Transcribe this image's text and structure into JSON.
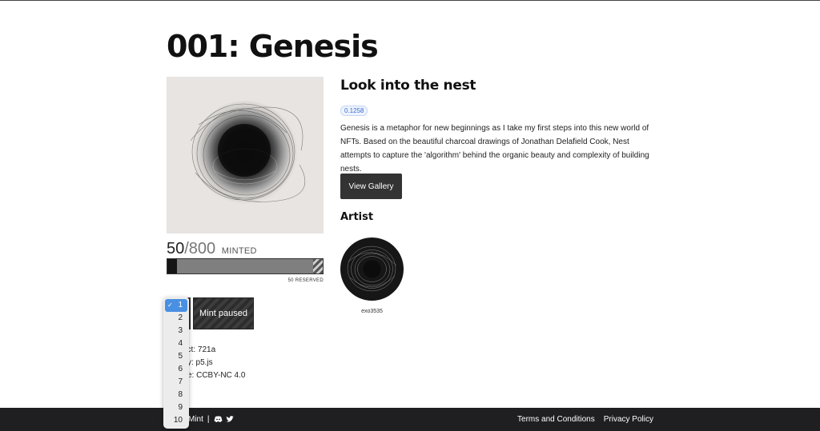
{
  "page": {
    "title": "001: Genesis"
  },
  "project": {
    "minted": "50",
    "total_label": "/800",
    "minted_word": "MINTED",
    "minted_count": 50,
    "total_supply": 800,
    "reserved_count": 50,
    "reserved_label": "50 RESERVED",
    "quantity_options": [
      "1",
      "2",
      "3",
      "4",
      "5",
      "6",
      "7",
      "8",
      "9",
      "10"
    ],
    "selected_quantity": "1",
    "mint_button": "Mint paused",
    "contract": "act: 721a",
    "library": "y: p5.js",
    "license": "e: CCBY-NC 4.0"
  },
  "details": {
    "heading": "Look into the nest",
    "hash": "0.1258",
    "description": "Genesis is a metaphor for new beginnings as I take my first steps into this new world of NFTs. Based on the beautiful charcoal drawings of Jonathan Delafield Cook, Nest attempts to capture the 'algorithm' behind the organic beauty and complexity of building nests.",
    "gallery_button": "View Gallery",
    "artist_heading": "Artist",
    "artist_name": "exo3535"
  },
  "footer": {
    "brand": "is Mint",
    "separator": "|",
    "icons": [
      "discord-icon",
      "twitter-icon"
    ],
    "terms": "Terms and Conditions",
    "privacy": "Privacy Policy"
  },
  "colors": {
    "footer_bg": "#1f1f22",
    "button_bg": "#333333",
    "select_highlight": "#4a90e2"
  }
}
